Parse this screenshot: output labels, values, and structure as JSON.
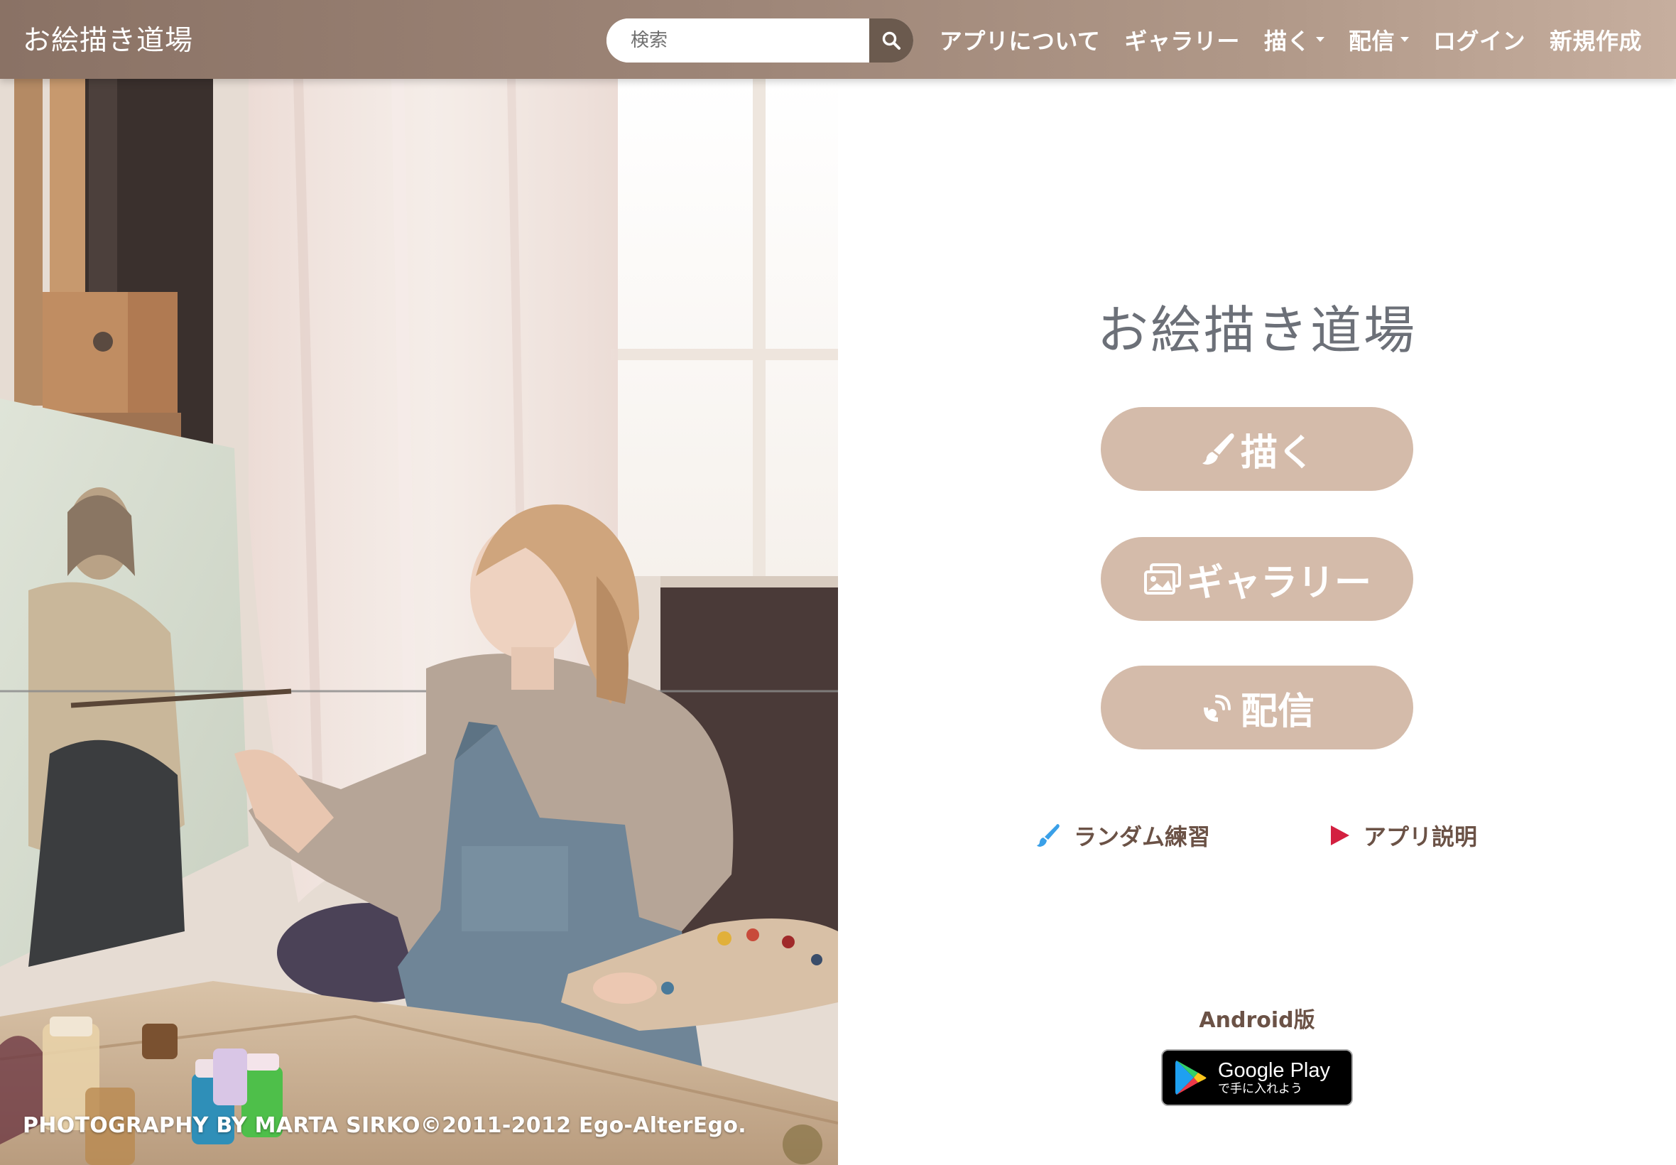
{
  "navbar": {
    "brand": "お絵描き道場",
    "search_placeholder": "検索",
    "links": {
      "about": "アプリについて",
      "gallery": "ギャラリー",
      "draw": "描く",
      "stream": "配信",
      "login": "ログイン",
      "signup": "新規作成"
    }
  },
  "hero": {
    "credit": "PHOTOGRAPHY BY MARTA SIRKO©2011-2012 Ego-AlterEgo."
  },
  "main": {
    "title": "お絵描き道場",
    "buttons": {
      "draw": "描く",
      "gallery": "ギャラリー",
      "stream": "配信"
    },
    "links": {
      "random_practice": "ランダム練習",
      "app_description": "アプリ説明"
    },
    "android_label": "Android版",
    "google_play": {
      "main": "Google Play",
      "sub": "で手に入れよう"
    }
  },
  "colors": {
    "navbar_start": "#8a7265",
    "navbar_end": "#c6ae9e",
    "button_bg": "#d4bbaa",
    "title_text": "#6c7078",
    "link_text": "#6b5246",
    "brush_icon": "#3aa0e8",
    "play_icon": "#d32040"
  },
  "icons": {
    "search": "search-icon",
    "draw": "paintbrush-icon",
    "gallery": "images-icon",
    "stream": "broadcast-icon",
    "random": "brush-icon",
    "about": "play-icon"
  }
}
